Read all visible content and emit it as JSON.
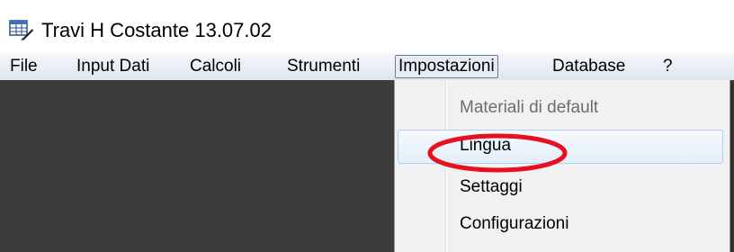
{
  "window": {
    "title": "Travi H Costante  13.07.02",
    "icon": "table-app-icon"
  },
  "menubar": {
    "items": [
      {
        "label": "File"
      },
      {
        "label": "Input Dati"
      },
      {
        "label": "Calcoli"
      },
      {
        "label": "Strumenti"
      },
      {
        "label": "Impostazioni"
      },
      {
        "label": "Database"
      },
      {
        "label": "?"
      }
    ],
    "open_item": "Impostazioni"
  },
  "dropdown": {
    "items": [
      {
        "label": "Materiali di default",
        "state": "disabled"
      },
      {
        "label": "Lingua",
        "state": "highlighted"
      },
      {
        "label": "Settaggi",
        "state": "normal"
      },
      {
        "label": "Configurazioni",
        "state": "normal"
      }
    ]
  },
  "colors": {
    "workspace": "#3c3c3c",
    "annotation": "#e8101e",
    "highlight_border": "#aecff7"
  }
}
